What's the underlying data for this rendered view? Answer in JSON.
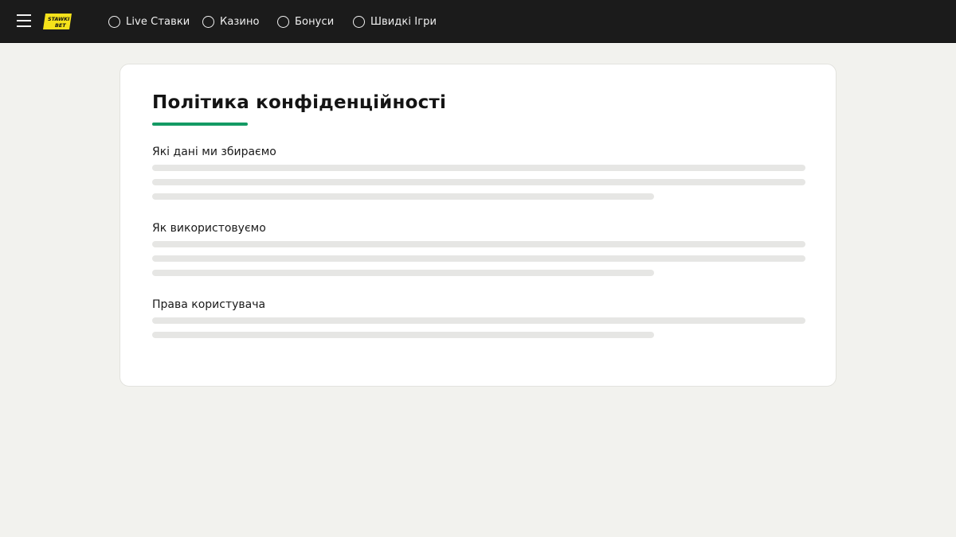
{
  "header": {
    "menu_icon": "hamburger-menu-icon",
    "logo": {
      "text_top": "STAWKI",
      "text_bottom": "BET",
      "color": "#f5e21b"
    },
    "nav": [
      {
        "label": "Live Ставки",
        "icon": "circle-icon"
      },
      {
        "label": "Казино",
        "icon": "circle-icon"
      },
      {
        "label": "Бонуси",
        "icon": "circle-icon"
      },
      {
        "label": "Швидкі Ігри",
        "icon": "circle-icon"
      }
    ]
  },
  "page": {
    "title": "Політика конфіденційності",
    "accent_color": "#149a64",
    "sections": [
      {
        "heading": "Які дані ми збираємо"
      },
      {
        "heading": "Як використовуємо"
      },
      {
        "heading": "Права користувача"
      }
    ]
  }
}
